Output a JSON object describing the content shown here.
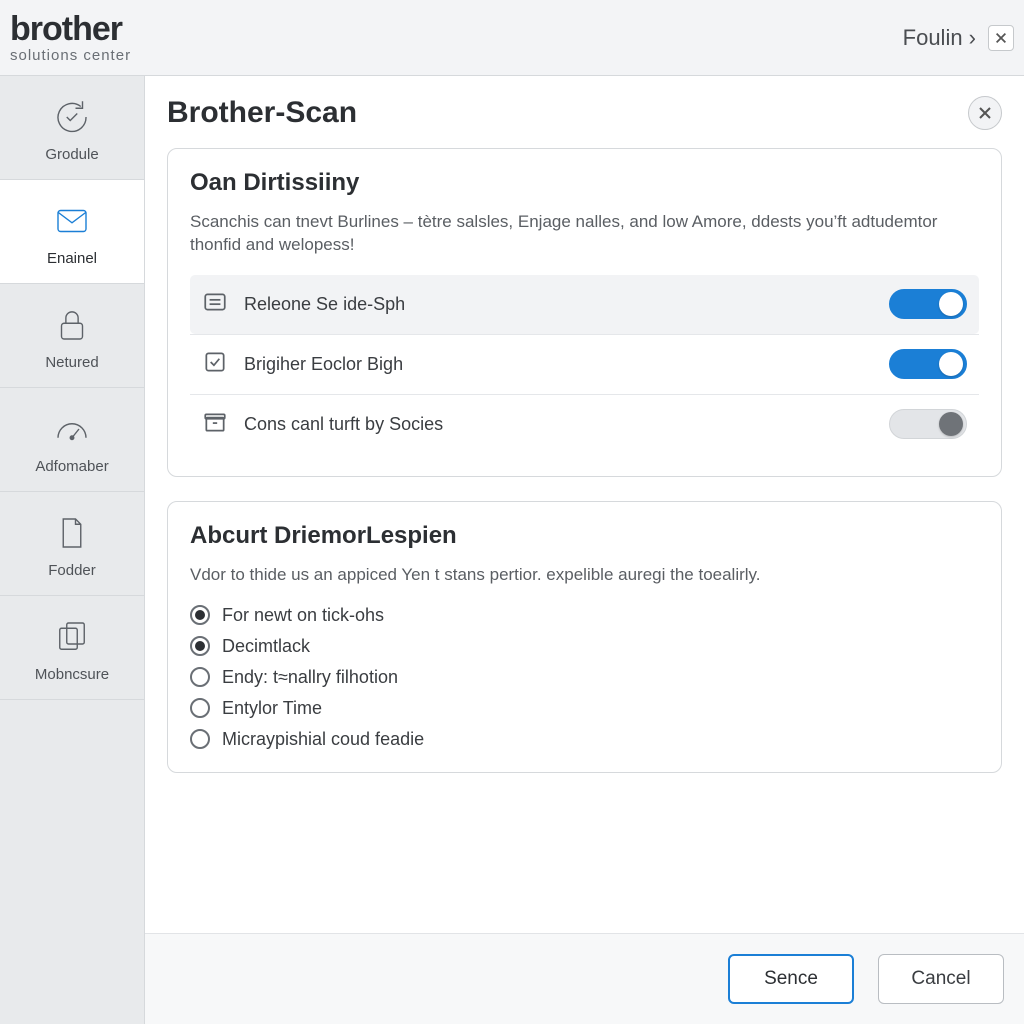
{
  "brand": {
    "name": "brother",
    "sub": "solutions center"
  },
  "header": {
    "right_label": "Foulin ›"
  },
  "sidebar": {
    "items": [
      {
        "label": "Grodule"
      },
      {
        "label": "Enainel"
      },
      {
        "label": "Netured"
      },
      {
        "label": "Adfomaber"
      },
      {
        "label": "Fodder"
      },
      {
        "label": "Mobncsure"
      }
    ]
  },
  "page": {
    "title": "Brother-Scan"
  },
  "panel1": {
    "title": "Oan Dirtissiiny",
    "desc": "Scanchis can tnevt Burlines – tètre salsles, Enjage nalles, and low Amore, ddests you’ft adtudemtor thonfid and welopess!",
    "rows": [
      {
        "label": "Releone Se ide-Sph"
      },
      {
        "label": "Brigiher Eoclor Bigh"
      },
      {
        "label": "Cons canl turft by Socies"
      }
    ]
  },
  "panel2": {
    "title": "Abcurt DriemorLespien",
    "desc": "Vdor to thide us an appiced Yen t stans pertior. expelible auregi the toealirly.",
    "options": [
      {
        "label": "For newt on tick-ohs"
      },
      {
        "label": "Decimtlack"
      },
      {
        "label": "Endy: t≈nallry filhotion"
      },
      {
        "label": "Entylor Time"
      },
      {
        "label": "Micraypishial coud feadie"
      }
    ]
  },
  "footer": {
    "primary": "Sence",
    "cancel": "Cancel"
  }
}
